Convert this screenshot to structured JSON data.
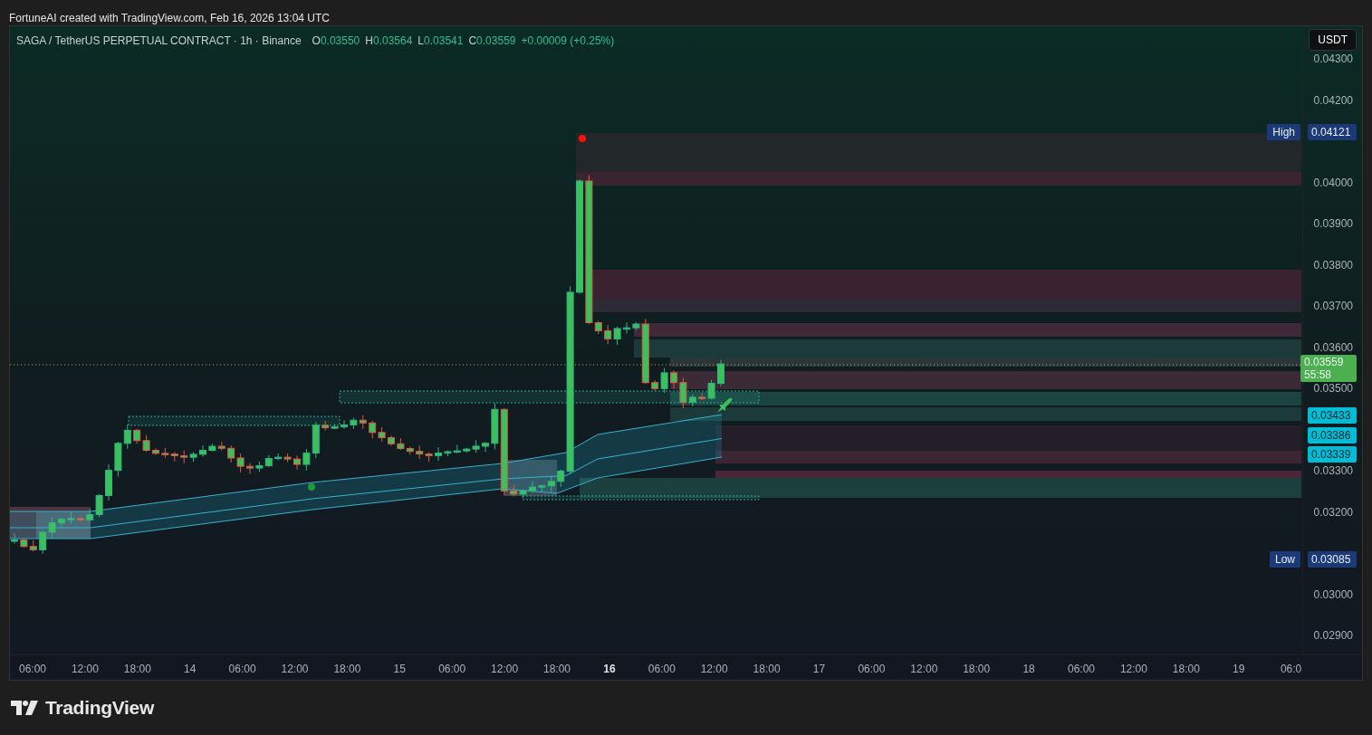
{
  "credit": "FortuneAI created with TradingView.com, Feb 16, 2026 13:04 UTC",
  "legend": {
    "title": "SAGA / TetherUS PERPETUAL CONTRACT · 1h · Binance",
    "ohlc": [
      {
        "label": "O",
        "value": "0.03550"
      },
      {
        "label": "H",
        "value": "0.03564"
      },
      {
        "label": "L",
        "value": "0.03541"
      },
      {
        "label": "C",
        "value": "0.03559"
      }
    ],
    "change": "+0.00009 (+0.25%)"
  },
  "currency_button": "USDT",
  "price_axis": [
    "0.04300",
    "0.04200",
    "0.04000",
    "0.03900",
    "0.03800",
    "0.03700",
    "0.03600",
    "0.03500",
    "0.03300",
    "0.03200",
    "0.03000",
    "0.02900"
  ],
  "price_tags": [
    {
      "kind": "high",
      "label": "High",
      "value": "0.04121"
    },
    {
      "kind": "last",
      "value": "0.03559",
      "countdown": "55:58"
    },
    {
      "kind": "level",
      "value": "0.03433"
    },
    {
      "kind": "level",
      "value": "0.03386"
    },
    {
      "kind": "level",
      "value": "0.03339"
    },
    {
      "kind": "low",
      "label": "Low",
      "value": "0.03085"
    }
  ],
  "time_axis": [
    {
      "label": "06:00",
      "emphasized": false
    },
    {
      "label": "12:00",
      "emphasized": false
    },
    {
      "label": "18:00",
      "emphasized": false
    },
    {
      "label": "14",
      "emphasized": false
    },
    {
      "label": "06:00",
      "emphasized": false
    },
    {
      "label": "12:00",
      "emphasized": false
    },
    {
      "label": "18:00",
      "emphasized": false
    },
    {
      "label": "15",
      "emphasized": false
    },
    {
      "label": "06:00",
      "emphasized": false
    },
    {
      "label": "12:00",
      "emphasized": false
    },
    {
      "label": "18:00",
      "emphasized": false
    },
    {
      "label": "16",
      "emphasized": true
    },
    {
      "label": "06:00",
      "emphasized": false
    },
    {
      "label": "12:00",
      "emphasized": false
    },
    {
      "label": "18:00",
      "emphasized": false
    },
    {
      "label": "17",
      "emphasized": false
    },
    {
      "label": "06:00",
      "emphasized": false
    },
    {
      "label": "12:00",
      "emphasized": false
    },
    {
      "label": "18:00",
      "emphasized": false
    },
    {
      "label": "18",
      "emphasized": false
    },
    {
      "label": "06:00",
      "emphasized": false
    },
    {
      "label": "12:00",
      "emphasized": false
    },
    {
      "label": "18:00",
      "emphasized": false
    },
    {
      "label": "19",
      "emphasized": false
    },
    {
      "label": "06:0",
      "emphasized": false
    }
  ],
  "brand": "TradingView"
}
